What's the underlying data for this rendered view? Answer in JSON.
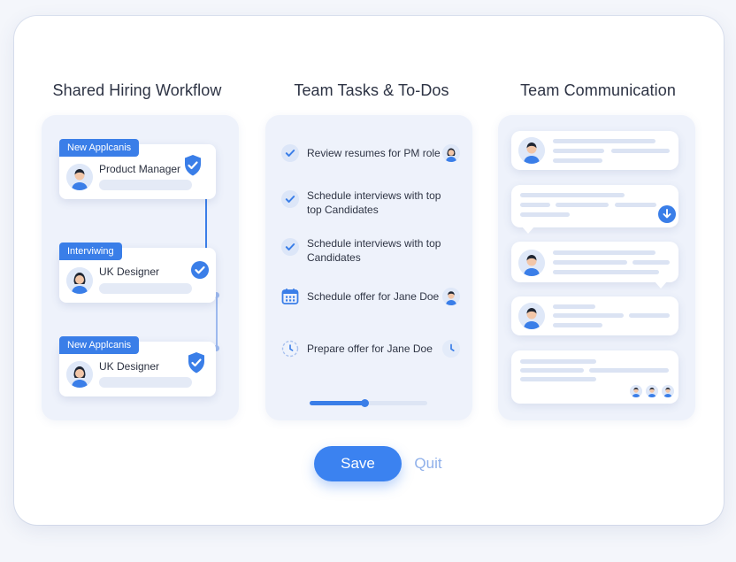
{
  "columns": {
    "hiring": {
      "title": "Shared Hiring Workflow",
      "cards": [
        {
          "tag": "New Applcanis",
          "role": "Product Manager",
          "badge": "shield-check"
        },
        {
          "tag": "Interviwing",
          "role": "UK Designer",
          "badge": "circle-check"
        },
        {
          "tag": "New Applcanis",
          "role": "UK Designer",
          "badge": "shield-check"
        }
      ]
    },
    "tasks": {
      "title": "Team Tasks & To-Dos",
      "items": [
        {
          "text": "Review resumes for PM role",
          "icon": "check-icon",
          "status": "done"
        },
        {
          "text": "Schedule interviews with top top Candidates",
          "icon": "check-icon",
          "status": "done"
        },
        {
          "text": "Schedule interviews with top Candidates",
          "icon": "check-icon",
          "status": "done"
        },
        {
          "text": "Schedule offer for Jane Doe",
          "icon": "calendar-icon",
          "status": "scheduled"
        },
        {
          "text": "Prepare offer for Jane Doe",
          "icon": "clock-icon",
          "status": "pending"
        }
      ],
      "progress": 0.47
    },
    "communication": {
      "title": "Team Communication",
      "messages": 5
    }
  },
  "actions": {
    "save_label": "Save",
    "quit_label": "Quit"
  },
  "colors": {
    "accent": "#3b82f0",
    "panel": "#eef2fb",
    "quit": "#8fb0ea"
  }
}
